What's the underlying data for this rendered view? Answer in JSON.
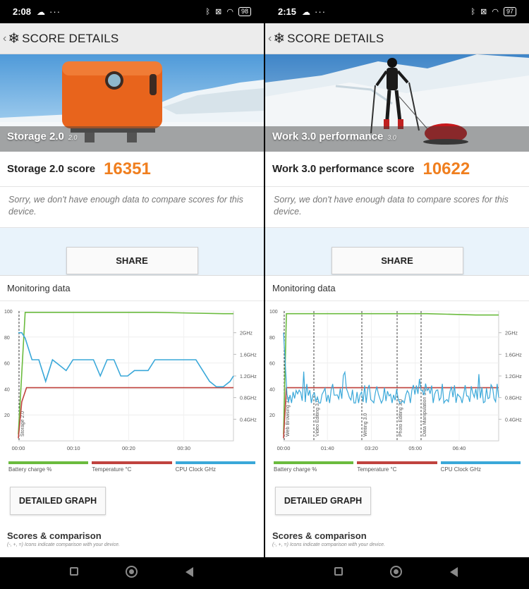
{
  "panels": [
    {
      "status": {
        "time": "2:08",
        "battery": "98"
      },
      "header_title": "SCORE DETAILS",
      "hero_label": "Storage 2.0",
      "hero_version": "2.0",
      "score_label": "Storage 2.0 score",
      "score_value": "16351",
      "note": "Sorry, we don't have enough data to compare scores for this device.",
      "share_label": "SHARE",
      "monitoring_title": "Monitoring data",
      "chart_data": {
        "type": "line",
        "y_left_ticks": [
          "100",
          "80",
          "60",
          "40",
          "20"
        ],
        "y_right_ticks": [
          "2GHz",
          "1.6GHz",
          "1.2GHz",
          "0.8GHz",
          "0.4GHz"
        ],
        "x_ticks": [
          "00:00",
          "00:10",
          "00:20",
          "00:30"
        ],
        "ylim": [
          0,
          100
        ],
        "markers": [
          "Storage 2.0"
        ],
        "series": [
          {
            "name": "Battery charge %",
            "color": "#6bbb3e",
            "x": [
              0,
              1,
              2,
              20,
              30,
              31.5
            ],
            "y": [
              5,
              99,
              99,
              99,
              98,
              98
            ]
          },
          {
            "name": "Temperature °C",
            "color": "#c0433f",
            "x": [
              0,
              0.5,
              1.2,
              10,
              20,
              31.5
            ],
            "y": [
              2,
              30,
              41,
              41,
              41,
              41
            ]
          },
          {
            "name": "CPU Clock GHz",
            "color": "#3aa8d9",
            "x": [
              0,
              0.5,
              1,
              2,
              3,
              4,
              5,
              6,
              7,
              8,
              9,
              10,
              11,
              12,
              13,
              14,
              15,
              16,
              17,
              18,
              19,
              20,
              21,
              22,
              23,
              24,
              25,
              26,
              27,
              28,
              29,
              30,
              31,
              31.5
            ],
            "y": [
              2.0,
              2.0,
              1.9,
              1.5,
              1.5,
              1.1,
              1.5,
              1.4,
              1.3,
              1.5,
              1.5,
              1.5,
              1.5,
              1.2,
              1.5,
              1.5,
              1.2,
              1.2,
              1.3,
              1.3,
              1.3,
              1.5,
              1.5,
              1.5,
              1.5,
              1.5,
              1.5,
              1.5,
              1.3,
              1.1,
              1.0,
              1.0,
              1.1,
              1.2
            ]
          }
        ]
      },
      "legend": [
        "Battery charge %",
        "Temperature °C",
        "CPU Clock GHz"
      ],
      "detail_label": "DETAILED GRAPH",
      "scores_title": "Scores & comparison",
      "scores_sub": "(-, +, =) Icons indicate comparison with your device."
    },
    {
      "status": {
        "time": "2:15",
        "battery": "97"
      },
      "header_title": "SCORE DETAILS",
      "hero_label": "Work 3.0 performance",
      "hero_version": "3.0",
      "score_label": "Work 3.0 performance score",
      "score_value": "10622",
      "note": "Sorry, we don't have enough data to compare scores for this device.",
      "share_label": "SHARE",
      "monitoring_title": "Monitoring data",
      "chart_data": {
        "type": "line",
        "y_left_ticks": [
          "100",
          "80",
          "60",
          "40",
          "20"
        ],
        "y_right_ticks": [
          "2GHz",
          "1.6GHz",
          "1.2GHz",
          "0.8GHz",
          "0.4GHz"
        ],
        "x_ticks": [
          "00:00",
          "01:40",
          "03:20",
          "05:00",
          "06:40"
        ],
        "ylim": [
          0,
          100
        ],
        "markers": [
          "Web Browsing 3.0",
          "Video Editing 3.0",
          "Writing 3.0",
          "Photo Editing 3.0",
          "Data Manipulation 3.0"
        ],
        "series": [
          {
            "name": "Battery charge %",
            "color": "#6bbb3e",
            "x": [
              0,
              0.1,
              5,
              6.7,
              7.5
            ],
            "y": [
              5,
              98,
              98,
              97,
              97
            ]
          },
          {
            "name": "Temperature °C",
            "color": "#c0433f",
            "x": [
              0,
              0.1,
              3,
              7.5
            ],
            "y": [
              2,
              41,
              41,
              41
            ]
          },
          {
            "name": "CPU Clock GHz",
            "color": "#3aa8d9",
            "noisy": true,
            "base": 0.85,
            "amp": 0.4,
            "count": 140,
            "x_max": 7.5
          }
        ]
      },
      "legend": [
        "Battery charge %",
        "Temperature °C",
        "CPU Clock GHz"
      ],
      "detail_label": "DETAILED GRAPH",
      "scores_title": "Scores & comparison",
      "scores_sub": "(-, +, =) Icons indicate comparison with your device."
    }
  ]
}
